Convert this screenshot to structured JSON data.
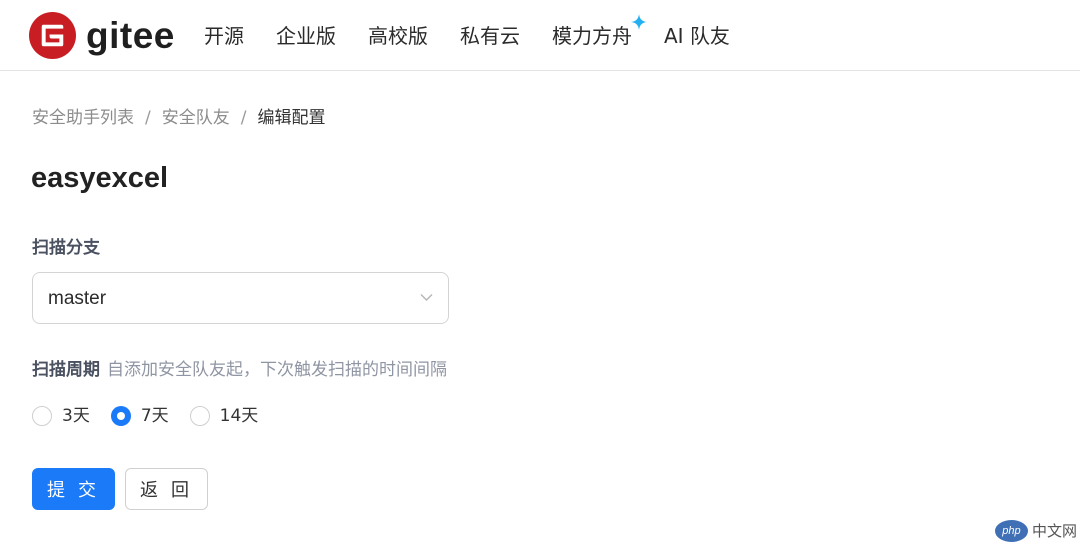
{
  "header": {
    "logo": {
      "icon": "gitee-logo-icon",
      "text": "gitee",
      "color": "#c71d23"
    },
    "nav": [
      {
        "label": "开源"
      },
      {
        "label": "企业版"
      },
      {
        "label": "高校版"
      },
      {
        "label": "私有云"
      },
      {
        "label": "模力方舟",
        "badge_icon": "sparkle-icon"
      },
      {
        "label": "AI 队友"
      }
    ]
  },
  "breadcrumb": {
    "items": [
      "安全助手列表",
      "安全队友",
      "编辑配置"
    ],
    "separator": "/"
  },
  "page": {
    "title": "easyexcel"
  },
  "form": {
    "branch": {
      "label": "扫描分支",
      "value": "master",
      "icon": "chevron-down-icon"
    },
    "period": {
      "label": "扫描周期",
      "hint": "自添加安全队友起，下次触发扫描的时间间隔",
      "options": [
        {
          "label": "3天",
          "checked": false
        },
        {
          "label": "7天",
          "checked": true
        },
        {
          "label": "14天",
          "checked": false
        }
      ]
    },
    "buttons": {
      "submit": "提 交",
      "back": "返 回"
    }
  },
  "watermark": {
    "badge": "php",
    "text": "中文网"
  },
  "colors": {
    "accent": "#1a7af8",
    "brand": "#c71d23",
    "sparkle": "#23b0f0"
  }
}
